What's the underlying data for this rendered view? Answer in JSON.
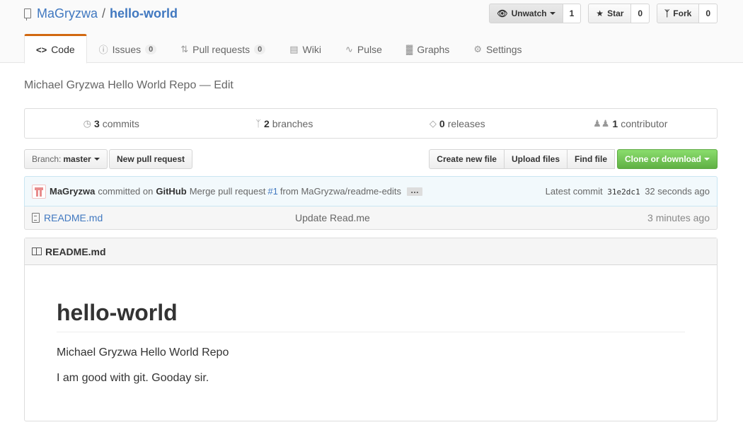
{
  "repo": {
    "owner": "MaGryzwa",
    "separator": "/",
    "name": "hello-world"
  },
  "actions": {
    "unwatch": {
      "label": "Unwatch",
      "count": "1"
    },
    "star": {
      "label": "Star",
      "count": "0"
    },
    "fork": {
      "label": "Fork",
      "count": "0"
    }
  },
  "tabs": [
    {
      "label": "Code",
      "icon": "code-icon",
      "selected": true
    },
    {
      "label": "Issues",
      "icon": "issue-icon",
      "count": "0"
    },
    {
      "label": "Pull requests",
      "icon": "pull-request-icon",
      "count": "0"
    },
    {
      "label": "Wiki",
      "icon": "book-icon"
    },
    {
      "label": "Pulse",
      "icon": "pulse-icon"
    },
    {
      "label": "Graphs",
      "icon": "graph-icon"
    },
    {
      "label": "Settings",
      "icon": "gear-icon"
    }
  ],
  "description": {
    "text": "Michael Gryzwa Hello World Repo",
    "dash": "—",
    "edit_label": "Edit"
  },
  "numbers": {
    "commits": {
      "count": "3",
      "label": "commits"
    },
    "branches": {
      "count": "2",
      "label": "branches"
    },
    "releases": {
      "count": "0",
      "label": "releases"
    },
    "contributors": {
      "count": "1",
      "label": "contributor"
    }
  },
  "file_nav": {
    "branch_prefix": "Branch:",
    "branch_name": "master",
    "new_pr_label": "New pull request",
    "create_file_label": "Create new file",
    "upload_label": "Upload files",
    "find_file_label": "Find file",
    "clone_label": "Clone or download"
  },
  "latest_commit": {
    "author": "MaGryzwa",
    "committed_on": "committed on",
    "committer": "GitHub",
    "message_prefix": "Merge pull request",
    "pr_number": "#1",
    "message_suffix": "from MaGryzwa/readme-edits",
    "ellipsis": "…",
    "latest_label": "Latest commit",
    "sha": "31e2dc1",
    "age": "32 seconds ago"
  },
  "files": [
    {
      "name": "README.md",
      "message": "Update Read.me",
      "age": "3 minutes ago"
    }
  ],
  "readme": {
    "filename": "README.md",
    "heading": "hello-world",
    "paragraphs": [
      "Michael Gryzwa Hello World Repo",
      "I am good with git. Gooday sir."
    ]
  },
  "colors": {
    "link": "#4078c0",
    "selected_tab_accent": "#d26911",
    "clone_button": "#60b044",
    "commit_tease_bg": "#f2f9fc"
  }
}
